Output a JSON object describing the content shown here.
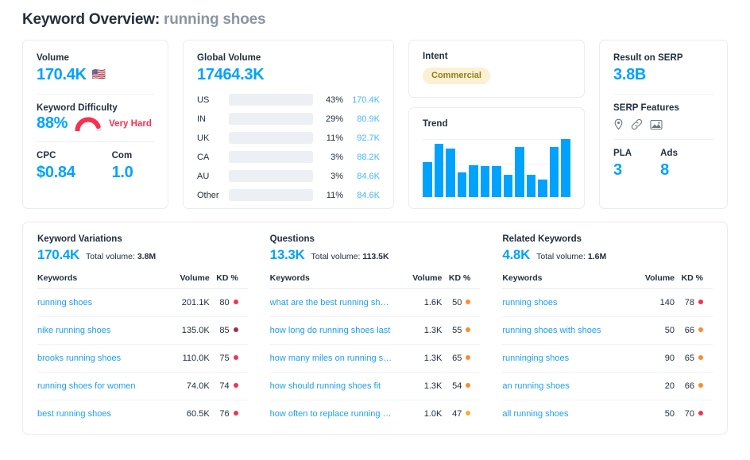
{
  "header": {
    "title": "Keyword Overview:",
    "keyword": "running shoes"
  },
  "volume_card": {
    "volume_label": "Volume",
    "volume_value": "170.4K",
    "flag": "🇺🇸",
    "kd_label": "Keyword Difficulty",
    "kd_value": "88%",
    "kd_percent": 88,
    "kd_word": "Very Hard",
    "kd_color": "#f8304f",
    "cpc_label": "CPC",
    "cpc_value": "$0.84",
    "com_label": "Com",
    "com_value": "1.0"
  },
  "global_volume": {
    "label": "Global Volume",
    "value": "17464.3K",
    "rows": [
      {
        "country": "US",
        "pct": "43%",
        "volume": "170.4K",
        "fill": 48
      },
      {
        "country": "IN",
        "pct": "29%",
        "volume": "80.9K",
        "fill": 20
      },
      {
        "country": "UK",
        "pct": "11%",
        "volume": "92.7K",
        "fill": 22
      },
      {
        "country": "CA",
        "pct": "3%",
        "volume": "88.2K",
        "fill": 8
      },
      {
        "country": "AU",
        "pct": "3%",
        "volume": "84.6K",
        "fill": 8
      },
      {
        "country": "Other",
        "pct": "11%",
        "volume": "84.6K",
        "fill": 18
      }
    ]
  },
  "intent": {
    "label": "Intent",
    "value": "Commercial"
  },
  "trend": {
    "label": "Trend"
  },
  "serp": {
    "result_label": "Result on SERP",
    "result_value": "3.8B",
    "features_label": "SERP Features",
    "features": [
      "location-pin-icon",
      "link-icon",
      "image-icon"
    ],
    "pla_label": "PLA",
    "pla_value": "3",
    "ads_label": "Ads",
    "ads_value": "8"
  },
  "tables": [
    {
      "title": "Keyword Variations",
      "count": "170.4K",
      "total_label": "Total volume:",
      "total_value": "3.8M",
      "columns": [
        "Keywords",
        "Volume",
        "KD %"
      ],
      "rows": [
        {
          "keyword": "running shoes",
          "volume": "201.1K",
          "kd": "80",
          "dot": "#f8304f"
        },
        {
          "keyword": "nike running shoes",
          "volume": "135.0K",
          "kd": "85",
          "dot": "#a32f4c"
        },
        {
          "keyword": "brooks running shoes",
          "volume": "110.0K",
          "kd": "75",
          "dot": "#f8304f"
        },
        {
          "keyword": "running shoes for women",
          "volume": "74.0K",
          "kd": "74",
          "dot": "#f8304f"
        },
        {
          "keyword": "best running shoes",
          "volume": "60.5K",
          "kd": "76",
          "dot": "#f8304f"
        }
      ]
    },
    {
      "title": "Questions",
      "count": "13.3K",
      "total_label": "Total volume:",
      "total_value": "113.5K",
      "columns": [
        "Keywords",
        "Volume",
        "KD %"
      ],
      "rows": [
        {
          "keyword": "what are the best running shoes",
          "volume": "1.6K",
          "kd": "50",
          "dot": "#ff8c28"
        },
        {
          "keyword": "how long do running shoes last",
          "volume": "1.3K",
          "kd": "55",
          "dot": "#ff8c28"
        },
        {
          "keyword": "how many miles on running shoes",
          "volume": "1.3K",
          "kd": "65",
          "dot": "#ff8c28"
        },
        {
          "keyword": "how should running shoes fit",
          "volume": "1.3K",
          "kd": "54",
          "dot": "#ff8c28"
        },
        {
          "keyword": "how often to replace running shoes",
          "volume": "1.0K",
          "kd": "47",
          "dot": "#ffad1f"
        }
      ]
    },
    {
      "title": "Related Keywords",
      "count": "4.8K",
      "total_label": "Total volume:",
      "total_value": "1.6M",
      "columns": [
        "Keywords",
        "Volume",
        "KD %"
      ],
      "rows": [
        {
          "keyword": "running shoes",
          "volume": "140",
          "kd": "78",
          "dot": "#f8304f"
        },
        {
          "keyword": "running shoes with shoes",
          "volume": "50",
          "kd": "66",
          "dot": "#ff8c28"
        },
        {
          "keyword": "runninging shoes",
          "volume": "90",
          "kd": "65",
          "dot": "#ff8c28"
        },
        {
          "keyword": "an running shoes",
          "volume": "20",
          "kd": "66",
          "dot": "#ff8c28"
        },
        {
          "keyword": "all running shoes",
          "volume": "50",
          "kd": "70",
          "dot": "#f8304f"
        }
      ]
    }
  ],
  "chart_data": {
    "type": "bar",
    "title": "Trend",
    "xlabel": "",
    "ylabel": "",
    "grid": true,
    "legend": "none",
    "categories": [
      "1",
      "2",
      "3",
      "4",
      "5",
      "6",
      "7",
      "8",
      "9",
      "10",
      "11",
      "12",
      "13"
    ],
    "values": [
      60,
      92,
      83,
      42,
      55,
      54,
      54,
      39,
      86,
      38,
      30,
      86,
      100
    ],
    "ylim": [
      0,
      100
    ]
  }
}
